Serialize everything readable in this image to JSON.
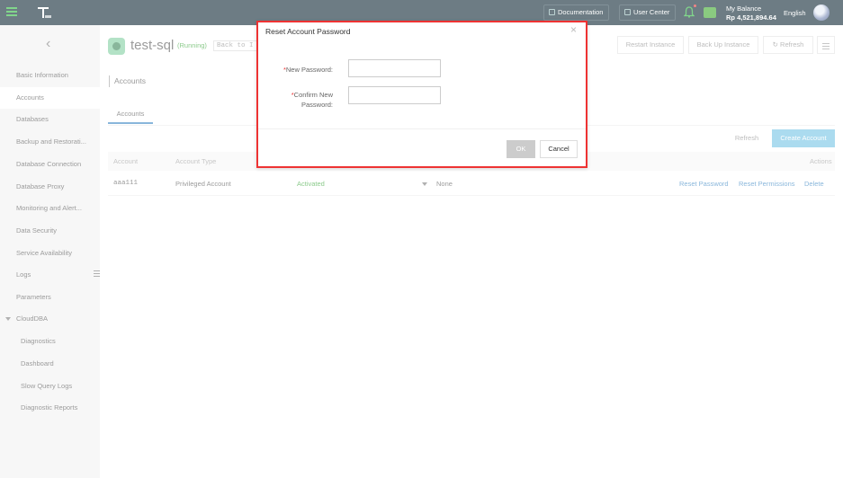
{
  "topbar": {
    "documentation_label": "Documentation",
    "user_center_label": "User Center",
    "balance_label": "My Balance",
    "balance_amount": "Rp 4,521,894.64",
    "language": "English"
  },
  "sidebar": {
    "items": [
      {
        "label": "Basic Information"
      },
      {
        "label": "Accounts"
      },
      {
        "label": "Databases"
      },
      {
        "label": "Backup and Restorati..."
      },
      {
        "label": "Database Connection"
      },
      {
        "label": "Database Proxy"
      },
      {
        "label": "Monitoring and Alert..."
      },
      {
        "label": "Data Security"
      },
      {
        "label": "Service Availability"
      },
      {
        "label": "Logs"
      },
      {
        "label": "Parameters"
      },
      {
        "label": "CloudDBA"
      },
      {
        "label": "Diagnostics"
      },
      {
        "label": "Dashboard"
      },
      {
        "label": "Slow Query Logs"
      },
      {
        "label": "Diagnostic Reports"
      }
    ]
  },
  "instance": {
    "name": "test-sql",
    "status": "(Running)",
    "back_to": "Back to I"
  },
  "actions": {
    "restart": "Restart Instance",
    "backup": "Back Up Instance",
    "refresh": "Refresh"
  },
  "section": {
    "title": "Accounts",
    "tab": "Accounts",
    "refresh": "Refresh",
    "create": "Create Account"
  },
  "table": {
    "headers": {
      "account": "Account",
      "type": "Account Type",
      "actions": "Actions"
    },
    "rows": [
      {
        "account": "aaa111",
        "type": "Privileged Account",
        "status": "Activated",
        "database": "None",
        "reset_password": "Reset Password",
        "reset_permissions": "Reset Permissions",
        "delete": "Delete"
      }
    ]
  },
  "dialog": {
    "title": "Reset Account Password",
    "required_mark": "*",
    "new_password_label": "New Password:",
    "confirm_label_line1": "Confirm New",
    "confirm_label_line2": "Password:",
    "new_password_value": "",
    "confirm_password_value": "",
    "ok": "OK",
    "cancel": "Cancel"
  },
  "colors": {
    "topbar": "#1f3742",
    "accent": "#7fc8e6",
    "link": "#4a90c8",
    "status_green": "#4cae4c",
    "dialog_highlight": "#e33333"
  }
}
